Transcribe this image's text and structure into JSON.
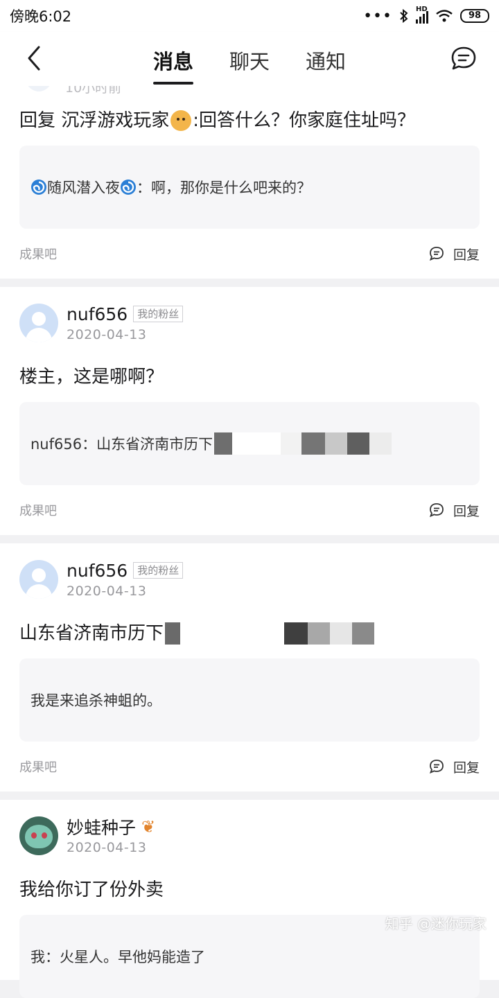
{
  "status_bar": {
    "time": "傍晚6:02",
    "dots": "•••",
    "network": "HD",
    "battery": "98"
  },
  "nav": {
    "tabs": [
      "消息",
      "聊天",
      "通知"
    ],
    "active_tab": "消息",
    "back_icon": "chevron-left-icon",
    "compose_icon": "chat-bubble-icon"
  },
  "cards": [
    {
      "partial_time": "10小时前",
      "main_text_prefix": "回复 沉浮游戏玩家",
      "main_text_suffix": ":回答什么？你家庭住址吗？",
      "quote_name": "随风潜入夜",
      "quote_text": "：啊，那你是什么吧来的？",
      "source": "成果吧",
      "reply_label": "回复"
    },
    {
      "username": "nuf656",
      "tag": "我的粉丝",
      "date": "2020-04-13",
      "main_text": "楼主，这是哪啊？",
      "quote_text": "nuf656：山东省济南市历下",
      "source": "成果吧",
      "reply_label": "回复"
    },
    {
      "username": "nuf656",
      "tag": "我的粉丝",
      "date": "2020-04-13",
      "main_text": "山东省济南市历下",
      "quote_text": "我是来追杀神蛆的。",
      "source": "成果吧",
      "reply_label": "回复"
    },
    {
      "username": "妙蛙种子",
      "date": "2020-04-13",
      "main_text": "我给你订了份外卖",
      "quote_text": "我：火星人。早他妈能造了"
    }
  ],
  "watermark": "知乎 @迷你玩家",
  "colors": {
    "page_bg": "#f1f1f3",
    "card_bg": "#ffffff",
    "quote_bg": "#f6f6f8",
    "muted": "#9a9a9e",
    "avatar_default": "#cfe0f7"
  }
}
